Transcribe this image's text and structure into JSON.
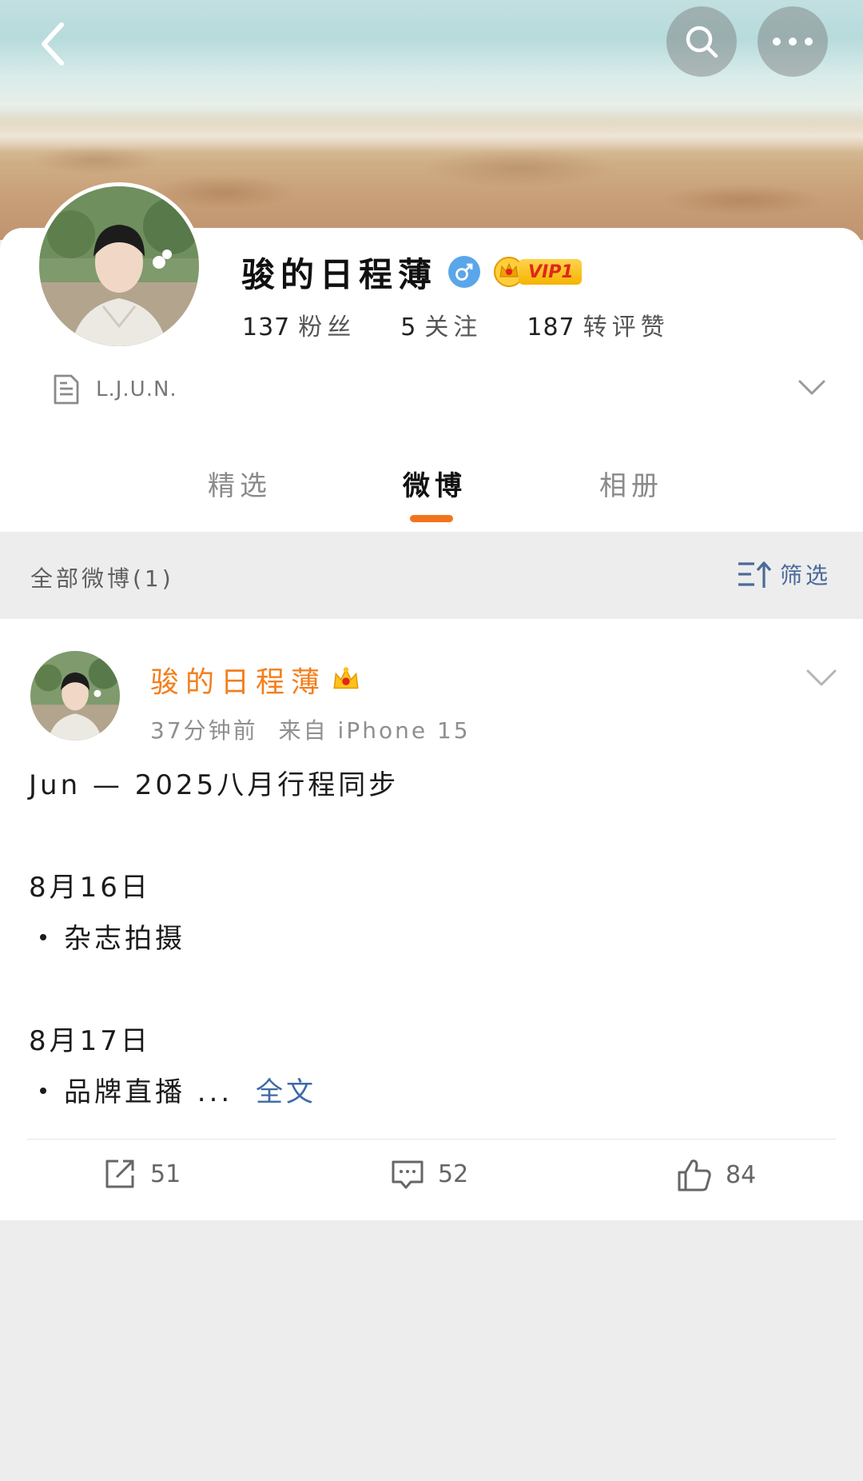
{
  "header": {
    "back_icon": "chevron-left-icon",
    "search_icon": "search-icon",
    "more_icon": "more-dots-icon"
  },
  "profile": {
    "name": "骏的日程薄",
    "gender": "♂",
    "vip_label": "VIP1",
    "stats": [
      {
        "num": "137",
        "label": "粉丝"
      },
      {
        "num": "5",
        "label": "关注"
      },
      {
        "num": "187",
        "label": "转评赞"
      }
    ],
    "bio": "L.J.U.N."
  },
  "tabs": [
    {
      "label": "精选",
      "active": false
    },
    {
      "label": "微博",
      "active": true
    },
    {
      "label": "相册",
      "active": false
    }
  ],
  "filter": {
    "label": "全部微博(1)",
    "button": "筛选"
  },
  "post": {
    "author": "骏的日程薄",
    "time": "37分钟前",
    "source": "来自 iPhone 15",
    "lines": {
      "title": "Jun — 2025八月行程同步",
      "date1": "8月16日",
      "item1": "杂志拍摄",
      "date2": "8月17日",
      "item2": "品牌直播 ...",
      "more": "全文"
    },
    "reposts": "51",
    "comments": "52",
    "likes": "84"
  },
  "colors": {
    "accent_orange": "#f3731c",
    "name_orange": "#f37f1c",
    "link_blue": "#3e6aa6",
    "gender_blue": "#5aa6ea"
  }
}
